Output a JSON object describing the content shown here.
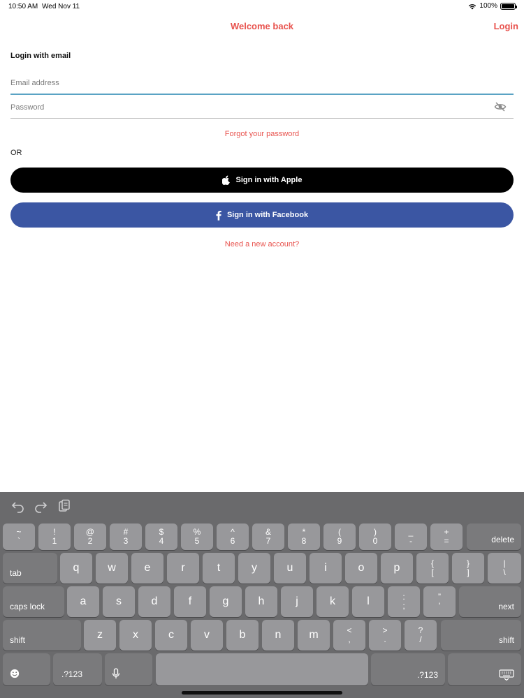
{
  "status_bar": {
    "time": "10:50 AM",
    "date": "Wed Nov 11",
    "battery": "100%"
  },
  "header": {
    "title": "Welcome back",
    "login_label": "Login"
  },
  "form": {
    "section_title": "Login with email",
    "email_placeholder": "Email address",
    "password_placeholder": "Password",
    "forgot_password": "Forgot your password",
    "or_label": "OR",
    "apple_button": "Sign in with Apple",
    "facebook_button": "Sign in with Facebook",
    "new_account": "Need a new account?"
  },
  "keyboard": {
    "number_row": [
      {
        "top": "~",
        "bottom": "`"
      },
      {
        "top": "!",
        "bottom": "1"
      },
      {
        "top": "@",
        "bottom": "2"
      },
      {
        "top": "#",
        "bottom": "3"
      },
      {
        "top": "$",
        "bottom": "4"
      },
      {
        "top": "%",
        "bottom": "5"
      },
      {
        "top": "^",
        "bottom": "6"
      },
      {
        "top": "&",
        "bottom": "7"
      },
      {
        "top": "*",
        "bottom": "8"
      },
      {
        "top": "(",
        "bottom": "9"
      },
      {
        "top": ")",
        "bottom": "0"
      },
      {
        "top": "_",
        "bottom": "-"
      },
      {
        "top": "+",
        "bottom": "="
      }
    ],
    "delete": "delete",
    "tab": "tab",
    "top_row": [
      "q",
      "w",
      "e",
      "r",
      "t",
      "y",
      "u",
      "i",
      "o",
      "p"
    ],
    "top_row_extra": [
      {
        "top": "{",
        "bottom": "["
      },
      {
        "top": "}",
        "bottom": "]"
      },
      {
        "top": "|",
        "bottom": "\\"
      }
    ],
    "caps_lock": "caps lock",
    "home_row": [
      "a",
      "s",
      "d",
      "f",
      "g",
      "h",
      "j",
      "k",
      "l"
    ],
    "home_row_extra": [
      {
        "top": ":",
        "bottom": ";"
      },
      {
        "top": "”",
        "bottom": "'"
      }
    ],
    "next": "next",
    "shift": "shift",
    "bottom_row": [
      "z",
      "x",
      "c",
      "v",
      "b",
      "n",
      "m"
    ],
    "bottom_row_extra": [
      {
        "top": "<",
        "bottom": ","
      },
      {
        "top": ">",
        "bottom": "."
      },
      {
        "top": "?",
        "bottom": "/"
      }
    ],
    "numbers_key": ".?123"
  }
}
